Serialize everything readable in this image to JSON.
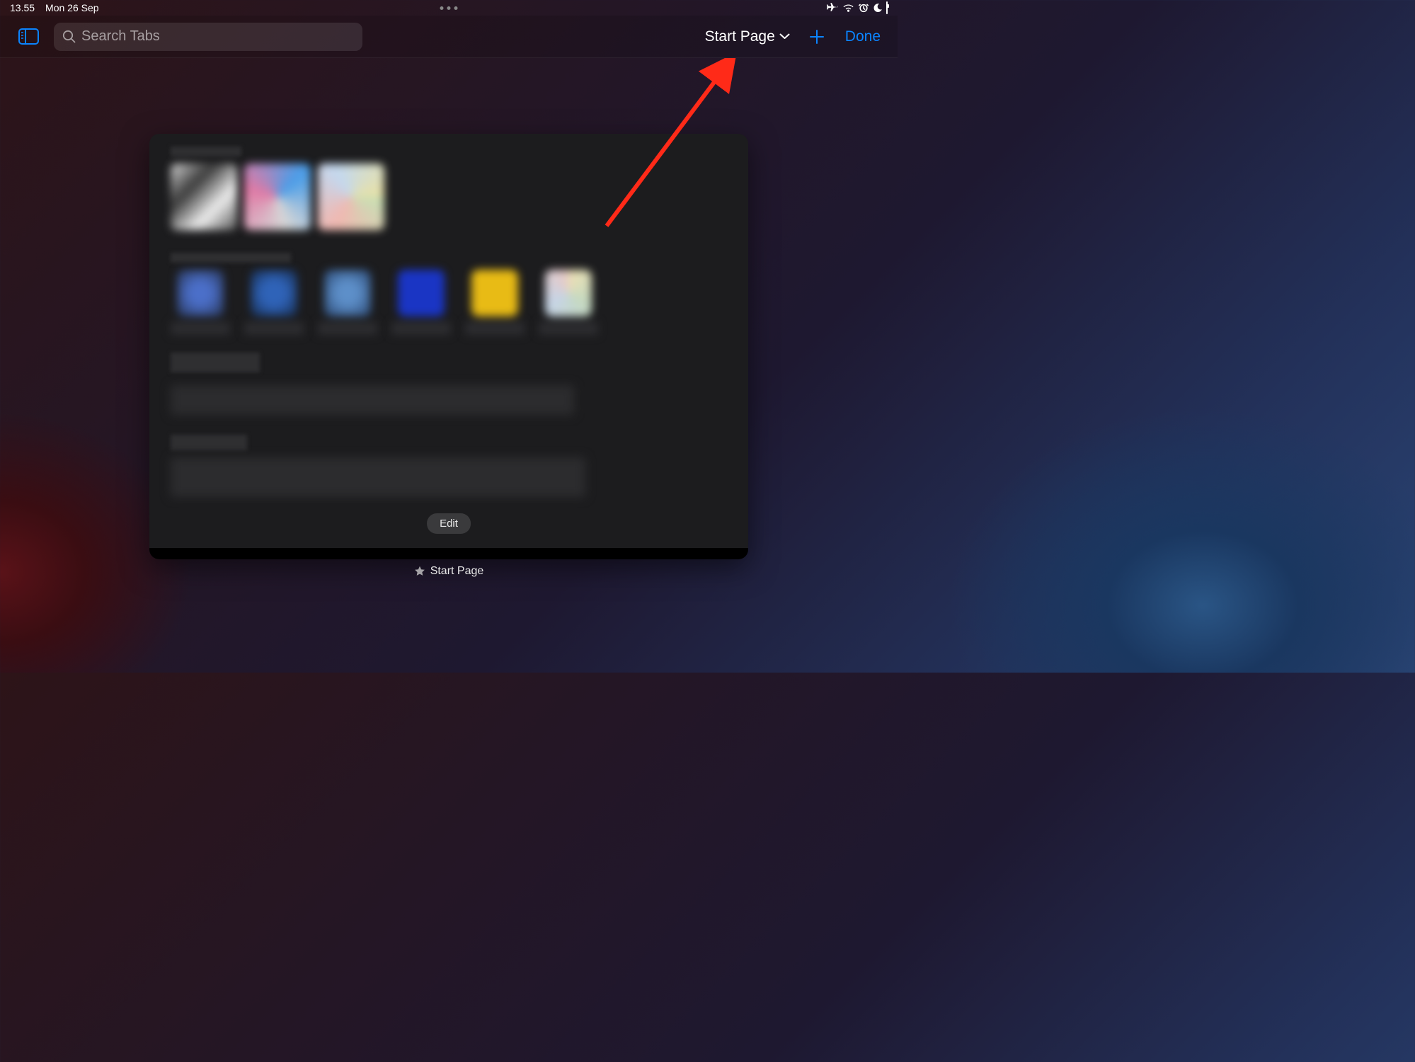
{
  "status": {
    "time": "13.55",
    "date": "Mon 26 Sep"
  },
  "toolbar": {
    "search_placeholder": "Search Tabs",
    "tab_group_label": "Start Page",
    "done_label": "Done"
  },
  "card": {
    "edit_label": "Edit"
  },
  "tab_label": "Start Page",
  "colors": {
    "accent": "#0b84ff"
  },
  "annotation": {
    "type": "arrow",
    "points_to": "tab-group-dropdown",
    "color": "#ff2a18"
  }
}
